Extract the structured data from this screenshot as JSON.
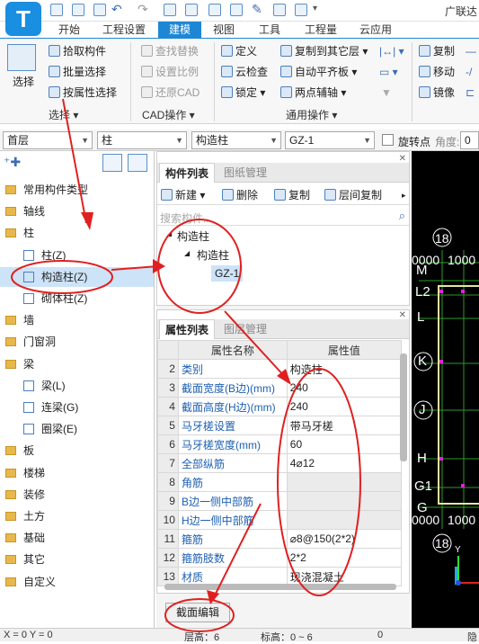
{
  "app": {
    "title": "广联达",
    "logo_letter": "T"
  },
  "tabs": [
    "开始",
    "工程设置",
    "建模",
    "视图",
    "工具",
    "工程量",
    "云应用"
  ],
  "active_tab": "建模",
  "ribbon": {
    "select_big": "选择",
    "select_items": [
      "拾取构件",
      "批量选择",
      "按属性选择"
    ],
    "select_group": "选择",
    "cad_items": [
      "查找替换",
      "设置比例",
      "还原CAD"
    ],
    "cad_group": "CAD操作",
    "common_col1": [
      "定义",
      "云检查",
      "锁定"
    ],
    "common_col2": [
      "复制到其它层",
      "自动平齐板",
      "两点辅轴"
    ],
    "common_group": "通用操作",
    "edit_items": [
      "复制",
      "移动",
      "镜像"
    ]
  },
  "filter": {
    "floor": "首层",
    "category": "柱",
    "type": "构造柱",
    "item": "GZ-1",
    "rotate_label": "旋转点",
    "angle_label": "角度:",
    "angle_value": "0"
  },
  "tree": {
    "items": [
      {
        "label": "常用构件类型",
        "kind": "folder"
      },
      {
        "label": "轴线",
        "kind": "folder"
      },
      {
        "label": "柱",
        "kind": "folder"
      },
      {
        "label": "柱(Z)",
        "kind": "sub"
      },
      {
        "label": "构造柱(Z)",
        "kind": "sel"
      },
      {
        "label": "砌体柱(Z)",
        "kind": "sub"
      },
      {
        "label": "墙",
        "kind": "folder"
      },
      {
        "label": "门窗洞",
        "kind": "folder"
      },
      {
        "label": "梁",
        "kind": "folder"
      },
      {
        "label": "梁(L)",
        "kind": "sub"
      },
      {
        "label": "连梁(G)",
        "kind": "sub"
      },
      {
        "label": "圈梁(E)",
        "kind": "sub"
      },
      {
        "label": "板",
        "kind": "folder"
      },
      {
        "label": "楼梯",
        "kind": "folder"
      },
      {
        "label": "装修",
        "kind": "folder"
      },
      {
        "label": "土方",
        "kind": "folder"
      },
      {
        "label": "基础",
        "kind": "folder"
      },
      {
        "label": "其它",
        "kind": "folder"
      },
      {
        "label": "自定义",
        "kind": "folder"
      }
    ]
  },
  "component_list": {
    "tabs": [
      "构件列表",
      "图纸管理"
    ],
    "toolbar": [
      "新建",
      "删除",
      "复制",
      "层间复制"
    ],
    "search_placeholder": "搜索构件...",
    "tree": [
      "构造柱",
      "构造柱",
      "GZ-1"
    ]
  },
  "properties": {
    "tabs": [
      "属性列表",
      "图层管理"
    ],
    "headers": [
      "属性名称",
      "属性值"
    ],
    "rows": [
      {
        "n": "2",
        "name": "类别",
        "val": "构造柱"
      },
      {
        "n": "3",
        "name": "截面宽度(B边)(mm)",
        "val": "240"
      },
      {
        "n": "4",
        "name": "截面高度(H边)(mm)",
        "val": "240"
      },
      {
        "n": "5",
        "name": "马牙槎设置",
        "val": "带马牙槎"
      },
      {
        "n": "6",
        "name": "马牙槎宽度(mm)",
        "val": "60"
      },
      {
        "n": "7",
        "name": "全部纵筋",
        "val": "4⌀12"
      },
      {
        "n": "8",
        "name": "角筋",
        "val": ""
      },
      {
        "n": "9",
        "name": "B边一侧中部筋",
        "val": ""
      },
      {
        "n": "10",
        "name": "H边一侧中部筋",
        "val": ""
      },
      {
        "n": "11",
        "name": "箍筋",
        "val": "⌀8@150(2*2)"
      },
      {
        "n": "12",
        "name": "箍筋肢数",
        "val": "2*2"
      },
      {
        "n": "13",
        "name": "材质",
        "val": "现浇混凝土"
      }
    ],
    "section_edit": "截面编辑"
  },
  "canvas": {
    "labels": [
      "18",
      "0000",
      "1000",
      "M",
      "L2",
      "L",
      "K",
      "J",
      "H",
      "G1",
      "G",
      "0000",
      "1000",
      "18"
    ]
  },
  "status": {
    "coords": "X = 0 Y = 0",
    "floor_height": "层高：6",
    "elev": "标高：0 ~ 6",
    "extra": "0",
    "right": "隐"
  }
}
